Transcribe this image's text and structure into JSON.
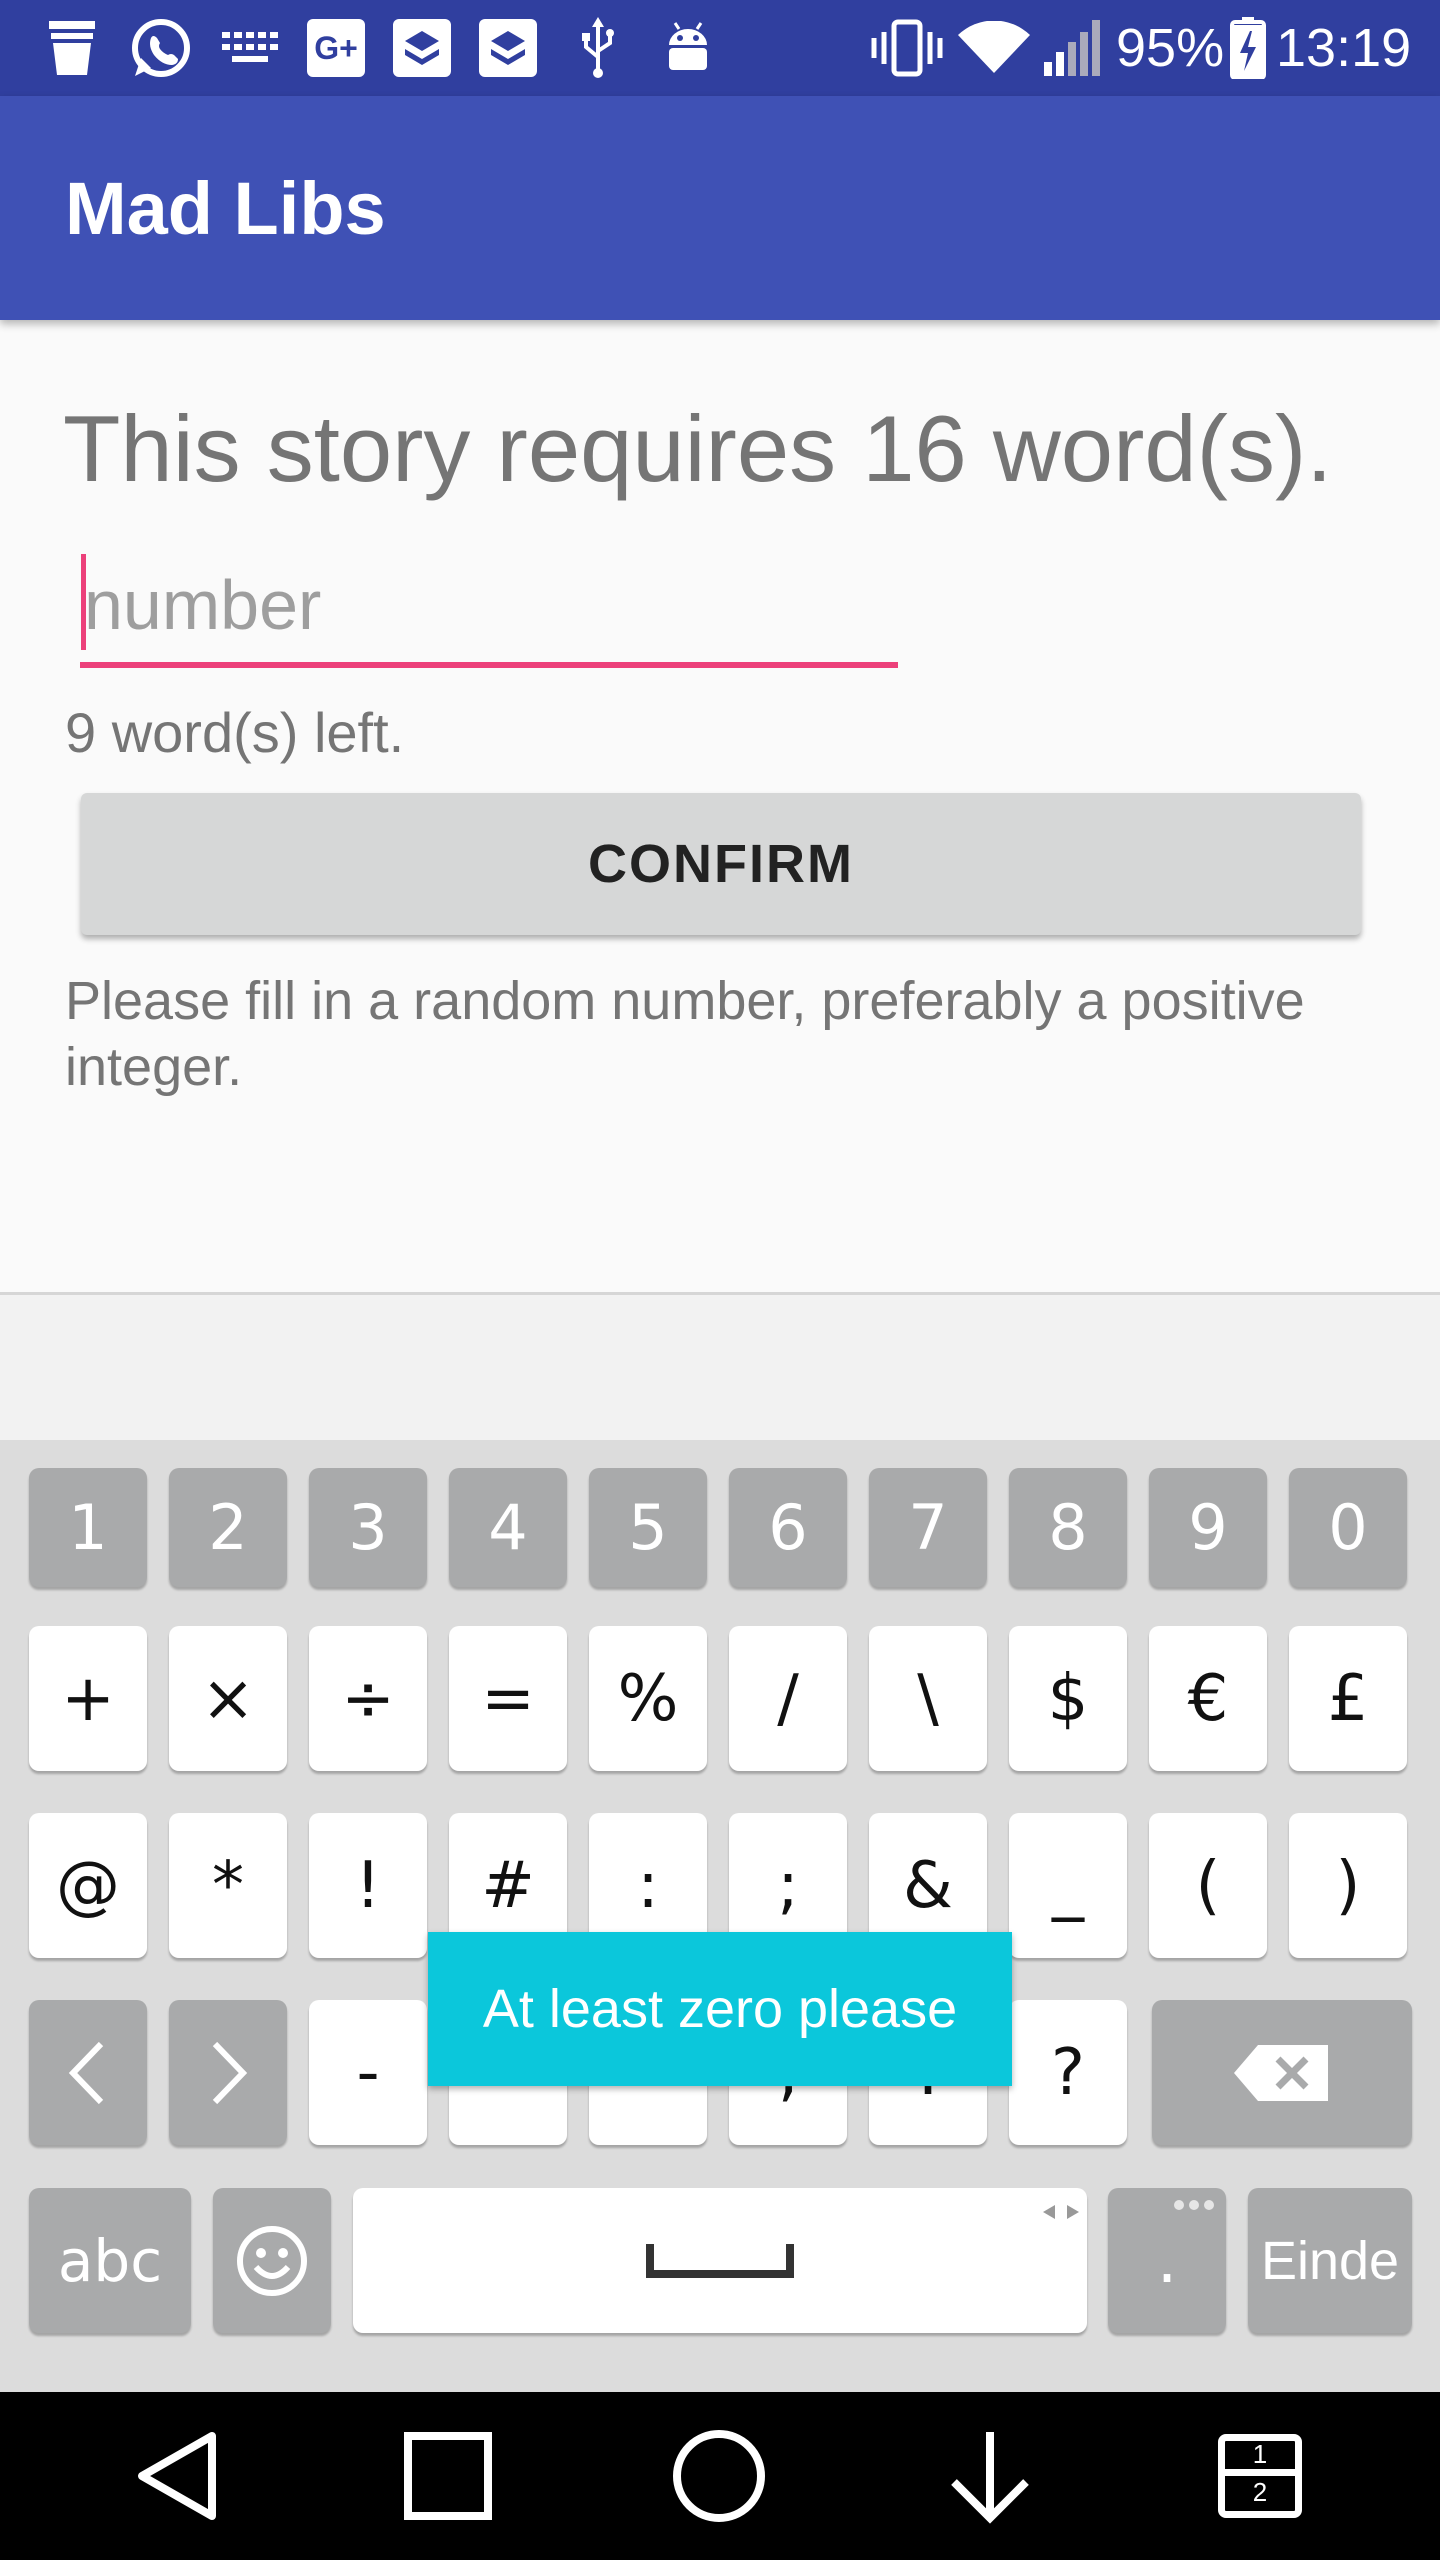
{
  "status_bar": {
    "left_icons": [
      "cup-icon",
      "whatsapp-icon",
      "keyboard-icon",
      "google-plus-icon",
      "layers-icon",
      "layers-icon",
      "usb-icon",
      "android-icon"
    ],
    "right_icons": [
      "vibrate-icon",
      "wifi-icon",
      "signal-icon",
      "battery-charging-icon"
    ],
    "battery": "95%",
    "time": "13:19",
    "gplus_label": "G+"
  },
  "app_bar": {
    "title": "Mad Libs"
  },
  "main": {
    "heading": "This story requires 16 word(s).",
    "input_placeholder": "number",
    "input_value": "",
    "words_left": "9 word(s) left.",
    "confirm_label": "CONFIRM",
    "instruction": "Please fill in a random number, preferably a positive integer."
  },
  "keyboard": {
    "number_row": [
      "1",
      "2",
      "3",
      "4",
      "5",
      "6",
      "7",
      "8",
      "9",
      "0"
    ],
    "symbol_row1": [
      "+",
      "×",
      "÷",
      "=",
      "%",
      "/",
      "\\",
      "$",
      "€",
      "£"
    ],
    "symbol_row2": [
      "@",
      "*",
      "!",
      "#",
      ":",
      ";",
      "&",
      "_",
      "(",
      ")"
    ],
    "symbol_row3": [
      "‹",
      "›",
      "-",
      "'",
      "\"",
      ",",
      ".",
      "?"
    ],
    "bottom_row": {
      "abc": "abc",
      "period": ".",
      "enter": "Einde"
    },
    "icons": [
      "backspace-icon",
      "emoji-icon",
      "space-icon"
    ]
  },
  "toast": {
    "message": "At least zero please"
  },
  "nav_bar": {
    "icons": [
      "back-icon",
      "recents-icon",
      "home-icon",
      "notification-pull-icon",
      "dual-window-icon"
    ],
    "dual_window_labels": [
      "1",
      "2"
    ]
  },
  "colors": {
    "status_bar": "#303f9f",
    "app_bar": "#3f51b5",
    "accent": "#ec407a",
    "toast": "#0bc7db"
  }
}
